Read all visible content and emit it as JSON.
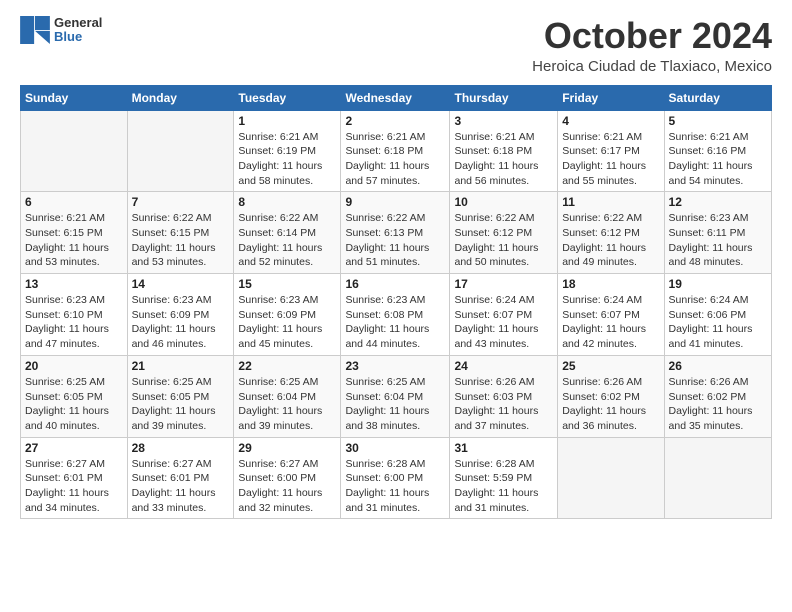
{
  "logo": {
    "general": "General",
    "blue": "Blue"
  },
  "header": {
    "month": "October 2024",
    "location": "Heroica Ciudad de Tlaxiaco, Mexico"
  },
  "weekdays": [
    "Sunday",
    "Monday",
    "Tuesday",
    "Wednesday",
    "Thursday",
    "Friday",
    "Saturday"
  ],
  "weeks": [
    [
      {
        "day": "",
        "info": ""
      },
      {
        "day": "",
        "info": ""
      },
      {
        "day": "1",
        "info": "Sunrise: 6:21 AM\nSunset: 6:19 PM\nDaylight: 11 hours and 58 minutes."
      },
      {
        "day": "2",
        "info": "Sunrise: 6:21 AM\nSunset: 6:18 PM\nDaylight: 11 hours and 57 minutes."
      },
      {
        "day": "3",
        "info": "Sunrise: 6:21 AM\nSunset: 6:18 PM\nDaylight: 11 hours and 56 minutes."
      },
      {
        "day": "4",
        "info": "Sunrise: 6:21 AM\nSunset: 6:17 PM\nDaylight: 11 hours and 55 minutes."
      },
      {
        "day": "5",
        "info": "Sunrise: 6:21 AM\nSunset: 6:16 PM\nDaylight: 11 hours and 54 minutes."
      }
    ],
    [
      {
        "day": "6",
        "info": "Sunrise: 6:21 AM\nSunset: 6:15 PM\nDaylight: 11 hours and 53 minutes."
      },
      {
        "day": "7",
        "info": "Sunrise: 6:22 AM\nSunset: 6:15 PM\nDaylight: 11 hours and 53 minutes."
      },
      {
        "day": "8",
        "info": "Sunrise: 6:22 AM\nSunset: 6:14 PM\nDaylight: 11 hours and 52 minutes."
      },
      {
        "day": "9",
        "info": "Sunrise: 6:22 AM\nSunset: 6:13 PM\nDaylight: 11 hours and 51 minutes."
      },
      {
        "day": "10",
        "info": "Sunrise: 6:22 AM\nSunset: 6:12 PM\nDaylight: 11 hours and 50 minutes."
      },
      {
        "day": "11",
        "info": "Sunrise: 6:22 AM\nSunset: 6:12 PM\nDaylight: 11 hours and 49 minutes."
      },
      {
        "day": "12",
        "info": "Sunrise: 6:23 AM\nSunset: 6:11 PM\nDaylight: 11 hours and 48 minutes."
      }
    ],
    [
      {
        "day": "13",
        "info": "Sunrise: 6:23 AM\nSunset: 6:10 PM\nDaylight: 11 hours and 47 minutes."
      },
      {
        "day": "14",
        "info": "Sunrise: 6:23 AM\nSunset: 6:09 PM\nDaylight: 11 hours and 46 minutes."
      },
      {
        "day": "15",
        "info": "Sunrise: 6:23 AM\nSunset: 6:09 PM\nDaylight: 11 hours and 45 minutes."
      },
      {
        "day": "16",
        "info": "Sunrise: 6:23 AM\nSunset: 6:08 PM\nDaylight: 11 hours and 44 minutes."
      },
      {
        "day": "17",
        "info": "Sunrise: 6:24 AM\nSunset: 6:07 PM\nDaylight: 11 hours and 43 minutes."
      },
      {
        "day": "18",
        "info": "Sunrise: 6:24 AM\nSunset: 6:07 PM\nDaylight: 11 hours and 42 minutes."
      },
      {
        "day": "19",
        "info": "Sunrise: 6:24 AM\nSunset: 6:06 PM\nDaylight: 11 hours and 41 minutes."
      }
    ],
    [
      {
        "day": "20",
        "info": "Sunrise: 6:25 AM\nSunset: 6:05 PM\nDaylight: 11 hours and 40 minutes."
      },
      {
        "day": "21",
        "info": "Sunrise: 6:25 AM\nSunset: 6:05 PM\nDaylight: 11 hours and 39 minutes."
      },
      {
        "day": "22",
        "info": "Sunrise: 6:25 AM\nSunset: 6:04 PM\nDaylight: 11 hours and 39 minutes."
      },
      {
        "day": "23",
        "info": "Sunrise: 6:25 AM\nSunset: 6:04 PM\nDaylight: 11 hours and 38 minutes."
      },
      {
        "day": "24",
        "info": "Sunrise: 6:26 AM\nSunset: 6:03 PM\nDaylight: 11 hours and 37 minutes."
      },
      {
        "day": "25",
        "info": "Sunrise: 6:26 AM\nSunset: 6:02 PM\nDaylight: 11 hours and 36 minutes."
      },
      {
        "day": "26",
        "info": "Sunrise: 6:26 AM\nSunset: 6:02 PM\nDaylight: 11 hours and 35 minutes."
      }
    ],
    [
      {
        "day": "27",
        "info": "Sunrise: 6:27 AM\nSunset: 6:01 PM\nDaylight: 11 hours and 34 minutes."
      },
      {
        "day": "28",
        "info": "Sunrise: 6:27 AM\nSunset: 6:01 PM\nDaylight: 11 hours and 33 minutes."
      },
      {
        "day": "29",
        "info": "Sunrise: 6:27 AM\nSunset: 6:00 PM\nDaylight: 11 hours and 32 minutes."
      },
      {
        "day": "30",
        "info": "Sunrise: 6:28 AM\nSunset: 6:00 PM\nDaylight: 11 hours and 31 minutes."
      },
      {
        "day": "31",
        "info": "Sunrise: 6:28 AM\nSunset: 5:59 PM\nDaylight: 11 hours and 31 minutes."
      },
      {
        "day": "",
        "info": ""
      },
      {
        "day": "",
        "info": ""
      }
    ]
  ]
}
